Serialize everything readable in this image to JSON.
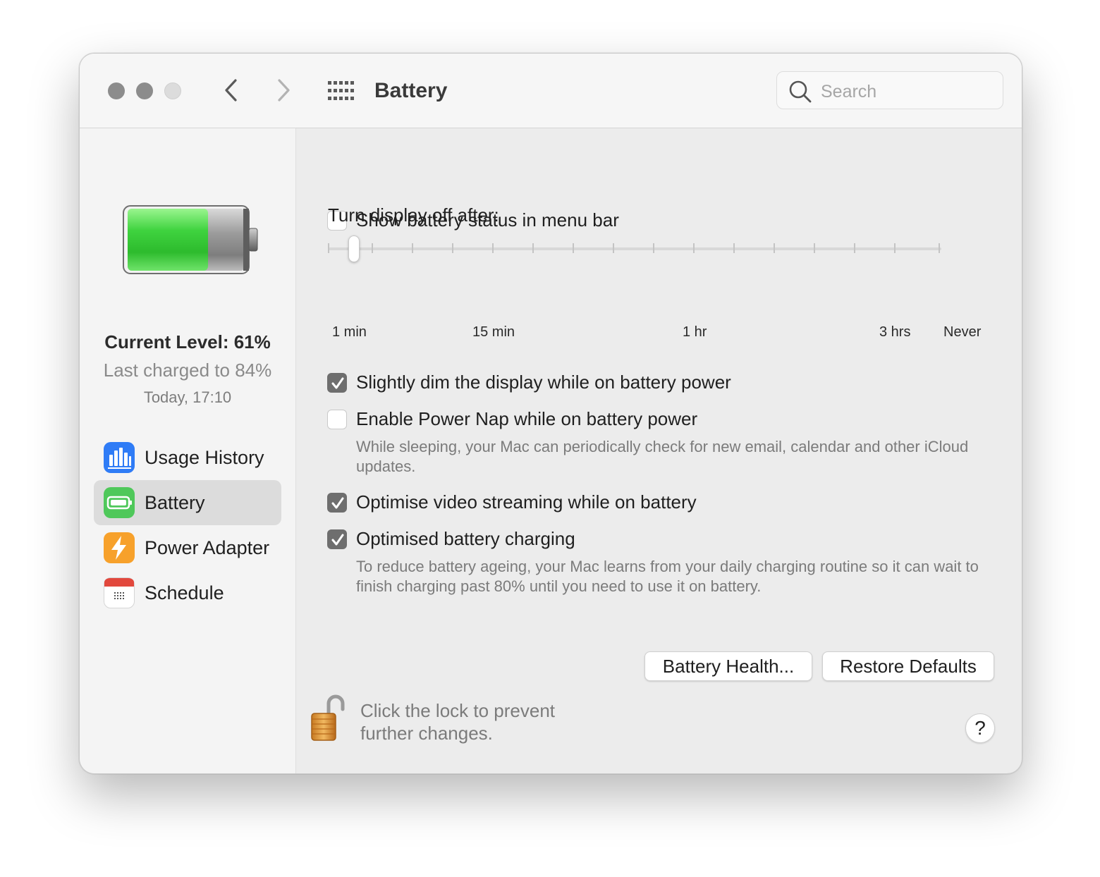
{
  "window": {
    "title": "Battery"
  },
  "toolbar": {
    "search_placeholder": "Search",
    "icons": [
      "back-icon",
      "forward-icon",
      "grid-icon",
      "search-icon"
    ]
  },
  "sidebar": {
    "current_level": "Current Level: 61%",
    "last_charged": "Last charged to 84%",
    "charged_time": "Today, 17:10",
    "battery_level_fraction": 0.61,
    "items": [
      {
        "label": "Usage History",
        "icon": "usage-history-icon",
        "color": "#2f7cf6",
        "selected": false
      },
      {
        "label": "Battery",
        "icon": "battery-icon",
        "color": "#4fc85a",
        "selected": true
      },
      {
        "label": "Power Adapter",
        "icon": "lightning-icon",
        "color": "#f7a12b",
        "selected": false
      },
      {
        "label": "Schedule",
        "icon": "calendar-icon",
        "color": "#e2483d",
        "selected": false
      }
    ]
  },
  "main": {
    "show_status": {
      "label": "Show battery status in menu bar",
      "checked": false
    },
    "slider": {
      "label": "Turn display off after:",
      "value": "1 min",
      "tick_labels": [
        "1 min",
        "15 min",
        "1 hr",
        "3 hrs",
        "Never"
      ]
    },
    "dim_display": {
      "label": "Slightly dim the display while on battery power",
      "checked": true
    },
    "power_nap": {
      "label": "Enable Power Nap while on battery power",
      "checked": false,
      "description": "While sleeping, your Mac can periodically check for new email, calendar and other iCloud updates."
    },
    "video_streaming": {
      "label": "Optimise video streaming while on battery",
      "checked": true
    },
    "optimised_charging": {
      "label": "Optimised battery charging",
      "checked": true,
      "description": "To reduce battery ageing, your Mac learns from your daily charging routine so it can wait to finish charging past 80% until you need to use it on battery."
    },
    "battery_health_button": "Battery Health...",
    "restore_defaults_button": "Restore Defaults",
    "lock_text": "Click the lock to prevent further changes.",
    "help_label": "?"
  },
  "colors": {
    "accent_checkbox": "#6e6e6e",
    "battery_green": "#3fd33f"
  }
}
